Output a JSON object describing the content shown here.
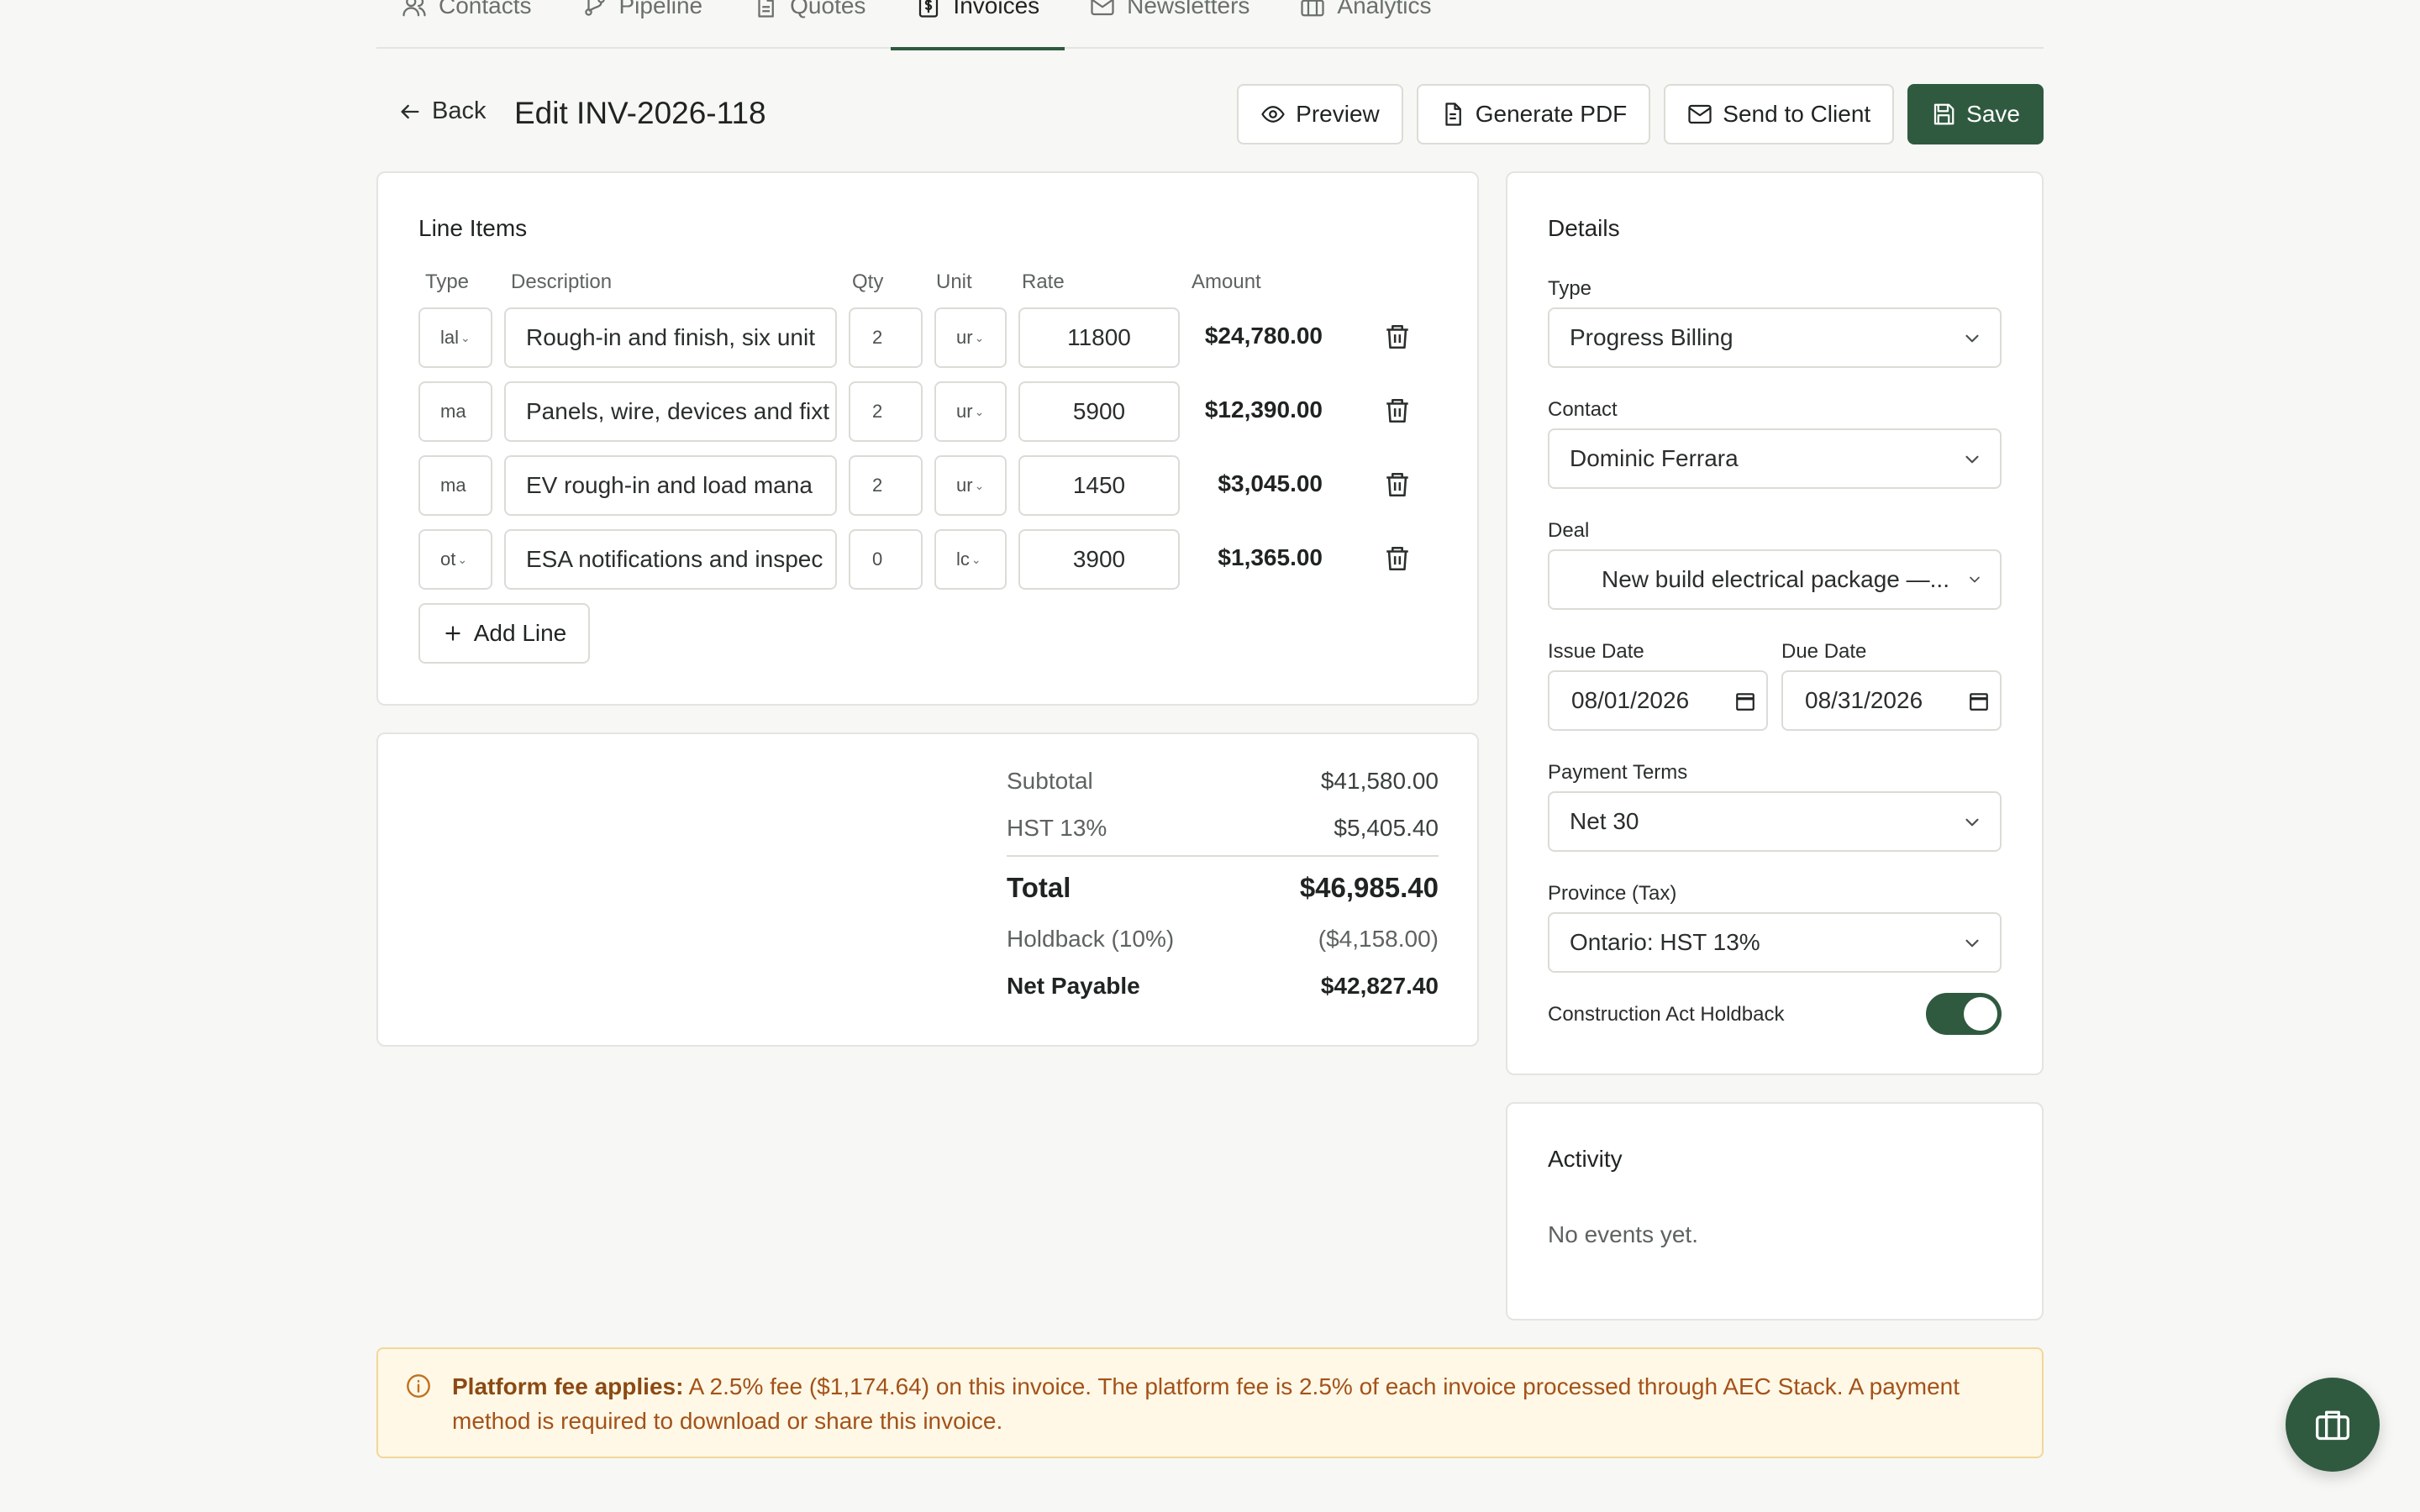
{
  "nav": {
    "tabs": [
      {
        "label": "Contacts",
        "icon": "users-icon"
      },
      {
        "label": "Pipeline",
        "icon": "git-branch-icon"
      },
      {
        "label": "Quotes",
        "icon": "document-icon"
      },
      {
        "label": "Invoices",
        "icon": "invoice-icon",
        "active": true
      },
      {
        "label": "Newsletters",
        "icon": "mail-icon"
      },
      {
        "label": "Analytics",
        "icon": "briefcase-icon"
      }
    ]
  },
  "header": {
    "back_label": "Back",
    "title": "Edit INV-2026-118",
    "preview_label": "Preview",
    "pdf_label": "Generate PDF",
    "send_label": "Send to Client",
    "save_label": "Save"
  },
  "line_items": {
    "title": "Line Items",
    "columns": {
      "type": "Type",
      "description": "Description",
      "qty": "Qty",
      "unit": "Unit",
      "rate": "Rate",
      "amount": "Amount"
    },
    "rows": [
      {
        "type": "lal",
        "description": "Rough-in and finish, six unit",
        "qty": "2",
        "unit": "ur",
        "rate": "11800",
        "amount": "$24,780.00"
      },
      {
        "type": "ma",
        "description": "Panels, wire, devices and fixt",
        "qty": "2",
        "unit": "ur",
        "rate": "5900",
        "amount": "$12,390.00"
      },
      {
        "type": "ma",
        "description": "EV rough-in and load mana",
        "qty": "2",
        "unit": "ur",
        "rate": "1450",
        "amount": "$3,045.00"
      },
      {
        "type": "ot",
        "description": "ESA notifications and inspec",
        "qty": "0",
        "unit": "lc",
        "rate": "3900",
        "amount": "$1,365.00"
      }
    ],
    "add_line_label": "Add Line"
  },
  "totals": {
    "subtotal_label": "Subtotal",
    "subtotal": "$41,580.00",
    "tax_label": "HST 13%",
    "tax": "$5,405.40",
    "total_label": "Total",
    "total": "$46,985.40",
    "holdback_label": "Holdback (10%)",
    "holdback": "($4,158.00)",
    "net_label": "Net Payable",
    "net": "$42,827.40"
  },
  "details": {
    "title": "Details",
    "type_label": "Type",
    "type_value": "Progress Billing",
    "contact_label": "Contact",
    "contact_value": "Dominic Ferrara",
    "deal_label": "Deal",
    "deal_value": "New build electrical package —...",
    "issue_date_label": "Issue Date",
    "issue_date": "08/01/2026",
    "due_date_label": "Due Date",
    "due_date": "08/31/2026",
    "terms_label": "Payment Terms",
    "terms_value": "Net 30",
    "province_label": "Province (Tax)",
    "province_value": "Ontario: HST 13%",
    "holdback_toggle_label": "Construction Act Holdback",
    "holdback_enabled": true
  },
  "activity": {
    "title": "Activity",
    "empty_text": "No events yet."
  },
  "banner": {
    "heading": "Platform fee applies:",
    "text": " A 2.5% fee ($1,174.64) on this invoice. The platform fee is 2.5% of each invoice processed through AEC Stack. A payment method is required to download or share this invoice."
  },
  "colors": {
    "accent": "#2f5a3f",
    "banner_bg": "#fff8e6",
    "banner_text": "#a3521a"
  }
}
